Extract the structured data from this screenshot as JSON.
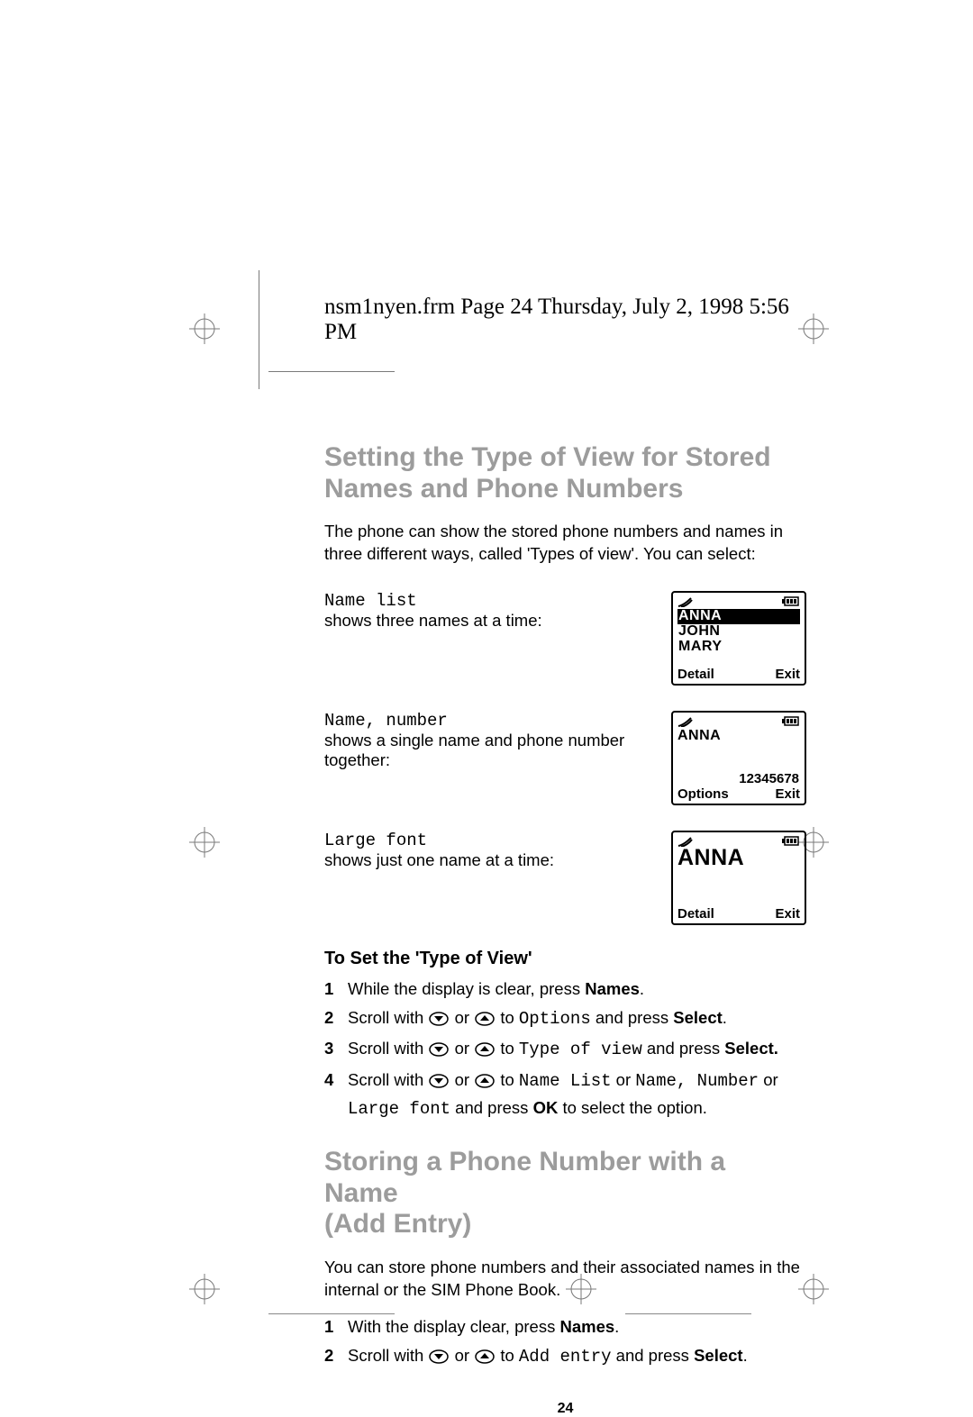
{
  "slug": "nsm1nyen.frm  Page 24  Thursday, July 2, 1998  5:56 PM",
  "section1_title_l1": "Setting the Type of View for Stored",
  "section1_title_l2": "Names and Phone Numbers",
  "section1_intro": "The phone can show the stored phone numbers and names in three different ways, called 'Types of view'. You can select:",
  "views": [
    {
      "code": "Name list",
      "desc": "shows three names at a time:",
      "lcd": {
        "line1": "ANNA",
        "line2": "JOHN",
        "line3": "MARY",
        "left": "Detail",
        "right": "Exit"
      }
    },
    {
      "code": "Name, number",
      "desc": "shows a single name and phone number together:",
      "lcd": {
        "name": "ANNA",
        "num": "12345678",
        "left": "Options",
        "right": "Exit"
      }
    },
    {
      "code": "Large font",
      "desc": "shows just one name at a time:",
      "lcd": {
        "big": "ANNA",
        "left": "Detail",
        "right": "Exit"
      }
    }
  ],
  "section1_sub": "To Set the 'Type of View'",
  "steps1": {
    "s1a": "While the display is clear, press ",
    "s1b": "Names",
    "s1c": ".",
    "s2a": "Scroll with ",
    "s2b": " or ",
    "s2c": " to ",
    "s2d": "Options",
    "s2e": " and press ",
    "s2f": "Select",
    "s2g": ".",
    "s3a": "Scroll with ",
    "s3b": " or ",
    "s3c": " to ",
    "s3d": "Type of view",
    "s3e": " and press ",
    "s3f": "Select.",
    "s4a": "Scroll with ",
    "s4b": " or ",
    "s4c": " to ",
    "s4d": "Name List",
    "s4e": " or ",
    "s4f": "Name, Number",
    "s4g": " or ",
    "s4h": "Large font",
    "s4i": " and press ",
    "s4j": "OK",
    "s4k": " to select the option."
  },
  "section2_title_l1": "Storing a Phone Number with a Name",
  "section2_title_l2": "(Add Entry)",
  "section2_intro": "You can store phone numbers and their associated names in the internal or the SIM Phone Book.",
  "steps2": {
    "s1a": "With the display clear, press ",
    "s1b": "Names",
    "s1c": ".",
    "s2a": "Scroll with ",
    "s2b": " or ",
    "s2c": " to ",
    "s2d": "Add entry",
    "s2e": " and press ",
    "s2f": "Select",
    "s2g": "."
  },
  "pagenum": "24"
}
